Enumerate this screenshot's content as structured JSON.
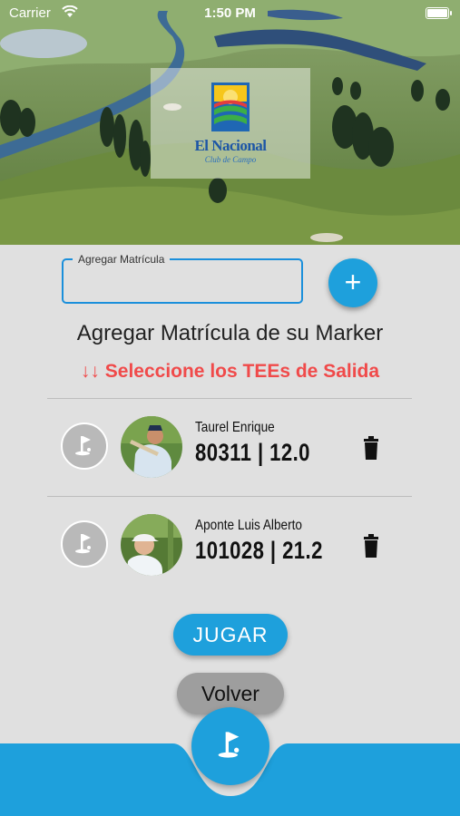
{
  "status_bar": {
    "carrier": "Carrier",
    "time": "1:50 PM"
  },
  "logo": {
    "name": "El Nacional",
    "subtitle": "Club de Campo"
  },
  "form": {
    "input_label": "Agregar Matrícula",
    "input_value": "",
    "add_label": "+"
  },
  "subtitle": "Agregar Matrícula de su Marker",
  "tee_message": "↓↓ Seleccione los TEEs de Salida",
  "players": [
    {
      "name": "Taurel Enrique",
      "info": "80311 | 12.0"
    },
    {
      "name": "Aponte Luis Alberto",
      "info": "101028 | 21.2"
    }
  ],
  "buttons": {
    "play": "JUGAR",
    "back": "Volver"
  },
  "colors": {
    "accent": "#1ea0dc",
    "warning": "#f04a4a",
    "background": "#e0e0e0"
  }
}
